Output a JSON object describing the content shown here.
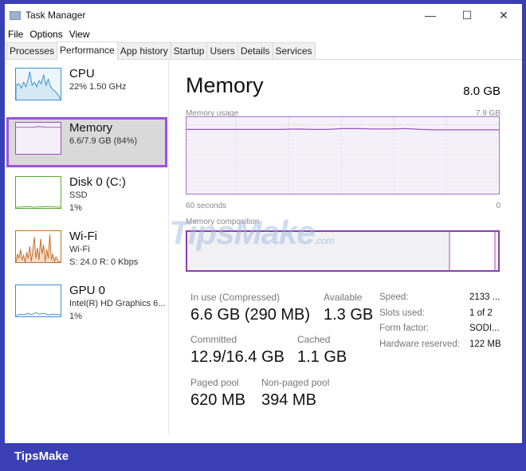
{
  "window": {
    "title": "Task Manager",
    "controls": [
      "—",
      "☐",
      "✕"
    ]
  },
  "menu": [
    "File",
    "Options",
    "View"
  ],
  "tabs": [
    "Processes",
    "Performance",
    "App history",
    "Startup",
    "Users",
    "Details",
    "Services"
  ],
  "sidebar": [
    {
      "name": "CPU",
      "line1": "22%  1.50 GHz",
      "line2": "",
      "color": "#3c8fd0"
    },
    {
      "name": "Memory",
      "line1": "6.6/7.9 GB (84%)",
      "line2": "",
      "color": "#9b4fc0"
    },
    {
      "name": "Disk 0 (C:)",
      "line1": "SSD",
      "line2": "1%",
      "color": "#5aa832"
    },
    {
      "name": "Wi-Fi",
      "line1": "Wi-Fi",
      "line2": "S: 24.0  R: 0 Kbps",
      "color": "#c86e24"
    },
    {
      "name": "GPU 0",
      "line1": "Intel(R) HD Graphics 6...",
      "line2": "1%",
      "color": "#3c8fd0"
    }
  ],
  "main": {
    "title": "Memory",
    "total": "8.0 GB",
    "usage_label": "Memory usage",
    "usage_max": "7.9 GB",
    "x_left": "60 seconds",
    "x_right": "0",
    "composition_label": "Memory composition",
    "usage_percent": [
      84,
      84,
      84,
      84,
      84,
      84,
      84,
      84.5,
      84,
      84,
      85,
      85,
      84.5,
      84.5,
      85,
      84,
      83.5,
      83.5,
      83.5,
      83.5,
      83.5
    ]
  },
  "stats": {
    "in_use_label": "In use (Compressed)",
    "in_use": "6.6 GB (290 MB)",
    "available_label": "Available",
    "available": "1.3 GB",
    "committed_label": "Committed",
    "committed": "12.9/16.4 GB",
    "cached_label": "Cached",
    "cached": "1.1 GB",
    "paged_label": "Paged pool",
    "paged": "620 MB",
    "nonpaged_label": "Non-paged pool",
    "nonpaged": "394 MB"
  },
  "details": [
    {
      "k": "Speed:",
      "v": "2133 ..."
    },
    {
      "k": "Slots used:",
      "v": "1 of 2"
    },
    {
      "k": "Form factor:",
      "v": "SODI..."
    },
    {
      "k": "Hardware reserved:",
      "v": "122 MB"
    }
  ],
  "watermark": "TipsMake",
  "watermark_suffix": ".com",
  "brand": "TipsMake"
}
